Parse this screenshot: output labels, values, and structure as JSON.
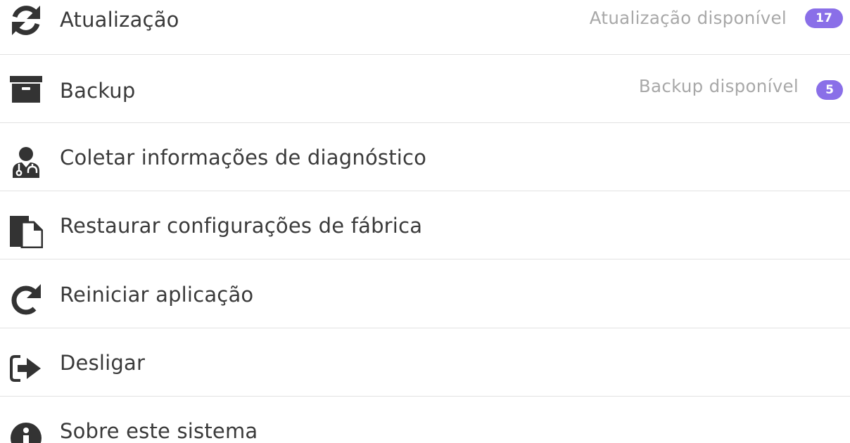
{
  "menu": {
    "accent_color": "#8a6fe8",
    "items": [
      {
        "icon": "refresh-icon",
        "label": "Atualização",
        "status": "Atualização disponível",
        "badge": "17"
      },
      {
        "icon": "archive-box-icon",
        "label": "Backup",
        "status": "Backup disponível",
        "badge": "5"
      },
      {
        "icon": "user-doctor-icon",
        "label": "Coletar informações de diagnóstico"
      },
      {
        "icon": "copy-documents-icon",
        "label": "Restaurar configurações de fábrica"
      },
      {
        "icon": "redo-icon",
        "label": "Reiniciar aplicação"
      },
      {
        "icon": "sign-out-icon",
        "label": "Desligar"
      },
      {
        "icon": "info-circle-icon",
        "label": "Sobre este sistema"
      }
    ]
  }
}
